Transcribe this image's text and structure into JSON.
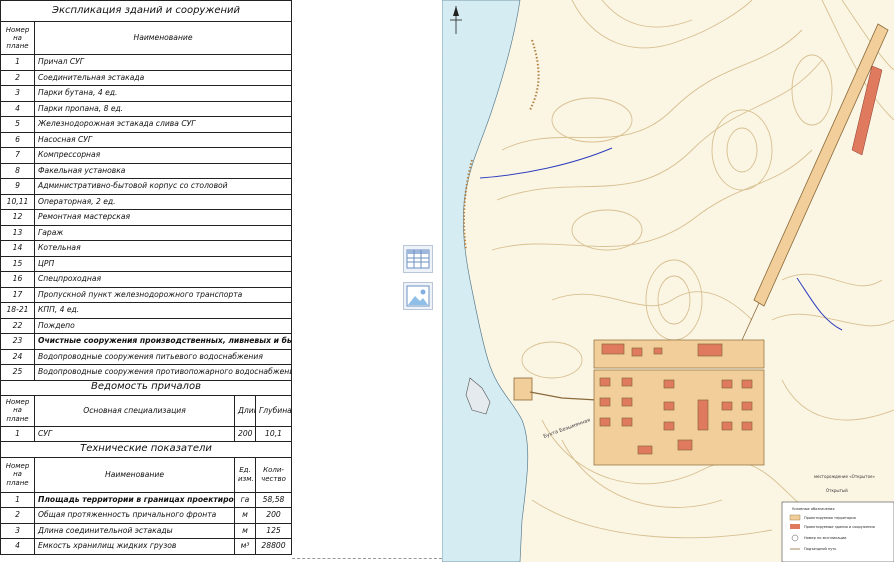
{
  "explication": {
    "title": "Экспликация зданий и сооружений",
    "col_number": "Номер на плане",
    "col_name": "Наименование",
    "rows": [
      {
        "num": "1",
        "name": "Причал СУГ"
      },
      {
        "num": "2",
        "name": "Соединительная эстакада"
      },
      {
        "num": "3",
        "name": "Парки бутана, 4 ед."
      },
      {
        "num": "4",
        "name": "Парки пропана, 8 ед."
      },
      {
        "num": "5",
        "name": "Железнодорожная эстакада слива СУГ"
      },
      {
        "num": "6",
        "name": "Насосная СУГ"
      },
      {
        "num": "7",
        "name": "Компрессорная"
      },
      {
        "num": "8",
        "name": "Факельная установка"
      },
      {
        "num": "9",
        "name": "Административно-бытовой корпус со столовой"
      },
      {
        "num": "10,11",
        "name": "Операторная, 2 ед."
      },
      {
        "num": "12",
        "name": "Ремонтная мастерская"
      },
      {
        "num": "13",
        "name": "Гараж"
      },
      {
        "num": "14",
        "name": "Котельная"
      },
      {
        "num": "15",
        "name": "ЦРП"
      },
      {
        "num": "16",
        "name": "Спецпроходная"
      },
      {
        "num": "17",
        "name": "Пропускной пункт железнодорожного транспорта"
      },
      {
        "num": "18-21",
        "name": "КПП, 4 ед."
      },
      {
        "num": "22",
        "name": "Пождепо"
      },
      {
        "num": "23",
        "name": "Очистные сооружения производственных, ливневых и бытовых сточных вод"
      },
      {
        "num": "24",
        "name": "Водопроводные сооружения питьевого водоснабжения"
      },
      {
        "num": "25",
        "name": "Водопроводные сооружения противопожарного водоснабжения"
      }
    ]
  },
  "berths": {
    "title": "Ведомость причалов",
    "col_number": "Номер на плане",
    "col_spec": "Основная специализация",
    "col_length": "Длина, м",
    "col_depth": "Глубина, м",
    "rows": [
      {
        "num": "1",
        "spec": "СУГ",
        "length": "200",
        "depth": "10,1"
      }
    ]
  },
  "indicators": {
    "title": "Технические показатели",
    "col_number": "Номер на плане",
    "col_name": "Наименование",
    "col_unit": "Ед. изм.",
    "col_qty": "Коли-чество",
    "rows": [
      {
        "num": "1",
        "name": "Площадь территории в границах проектирования",
        "unit": "га",
        "qty": "58,58"
      },
      {
        "num": "2",
        "name": "Общая протяженность причального фронта",
        "unit": "м",
        "qty": "200"
      },
      {
        "num": "3",
        "name": "Длина соединительной эстакады",
        "unit": "м",
        "qty": "125"
      },
      {
        "num": "4",
        "name": "Емкость хранилищ жидких грузов",
        "unit": "м³",
        "qty": "28800"
      }
    ]
  },
  "map": {
    "labels": {
      "shore": "Бухта Безымянная",
      "deposit": "месторождение «Открытое»",
      "settlement": "Открытый"
    },
    "legend": {
      "title": "Условные обозначения",
      "items": [
        "Проектируемая территория",
        "Проектируемые здания и сооружения",
        "Номер по экспликации",
        "Подъездной путь"
      ]
    },
    "colors": {
      "background": "#fbf5e4",
      "contour": "#d8c090",
      "water": "#d6ecf3",
      "site": "#f2cf9a",
      "building": "#e07a5f",
      "stream": "#2f3fbf"
    }
  },
  "icons": [
    "table-icon",
    "image-icon",
    "compass-icon"
  ]
}
